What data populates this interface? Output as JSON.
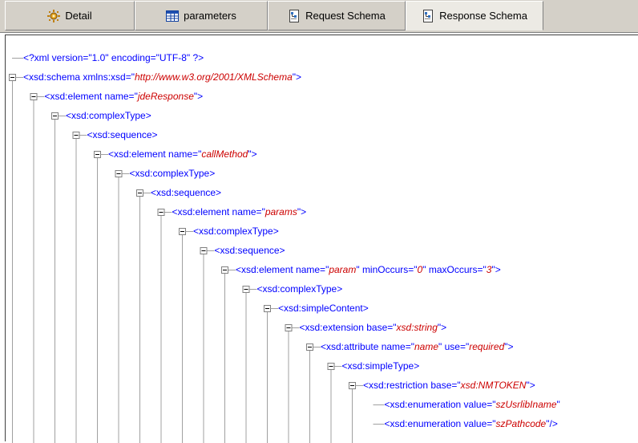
{
  "tabs": [
    {
      "label": "Detail",
      "icon": "detail-icon",
      "active": false
    },
    {
      "label": "parameters",
      "icon": "table-icon",
      "active": false
    },
    {
      "label": "Request Schema",
      "icon": "schema-icon",
      "active": false
    },
    {
      "label": "Response Schema",
      "icon": "schema-icon",
      "active": true
    }
  ],
  "tree": [
    {
      "depth": 0,
      "expander": false,
      "parts": [
        [
          "b",
          "<?xml version=\"1.0\" encoding=\"UTF-8\" ?>"
        ]
      ]
    },
    {
      "depth": 0,
      "expander": true,
      "parts": [
        [
          "b",
          "<xsd:schema xmlns:xsd=\""
        ],
        [
          "i",
          "http://www.w3.org/2001/XMLSchema"
        ],
        [
          "b",
          "\">"
        ]
      ]
    },
    {
      "depth": 1,
      "expander": true,
      "parts": [
        [
          "b",
          "<xsd:element name=\""
        ],
        [
          "i",
          "jdeResponse"
        ],
        [
          "b",
          "\">"
        ]
      ]
    },
    {
      "depth": 2,
      "expander": true,
      "parts": [
        [
          "b",
          "<xsd:complexType>"
        ]
      ]
    },
    {
      "depth": 3,
      "expander": true,
      "parts": [
        [
          "b",
          "<xsd:sequence>"
        ]
      ]
    },
    {
      "depth": 4,
      "expander": true,
      "parts": [
        [
          "b",
          "<xsd:element name=\""
        ],
        [
          "i",
          "callMethod"
        ],
        [
          "b",
          "\">"
        ]
      ]
    },
    {
      "depth": 5,
      "expander": true,
      "parts": [
        [
          "b",
          "<xsd:complexType>"
        ]
      ]
    },
    {
      "depth": 6,
      "expander": true,
      "parts": [
        [
          "b",
          "<xsd:sequence>"
        ]
      ]
    },
    {
      "depth": 7,
      "expander": true,
      "parts": [
        [
          "b",
          "<xsd:element name=\""
        ],
        [
          "i",
          "params"
        ],
        [
          "b",
          "\">"
        ]
      ]
    },
    {
      "depth": 8,
      "expander": true,
      "parts": [
        [
          "b",
          "<xsd:complexType>"
        ]
      ]
    },
    {
      "depth": 9,
      "expander": true,
      "parts": [
        [
          "b",
          "<xsd:sequence>"
        ]
      ]
    },
    {
      "depth": 10,
      "expander": true,
      "parts": [
        [
          "b",
          "<xsd:element name=\""
        ],
        [
          "i",
          "param"
        ],
        [
          "b",
          "\" minOccurs=\""
        ],
        [
          "i",
          "0"
        ],
        [
          "b",
          "\" maxOccurs=\""
        ],
        [
          "i",
          "3"
        ],
        [
          "b",
          "\">"
        ]
      ]
    },
    {
      "depth": 11,
      "expander": true,
      "parts": [
        [
          "b",
          "<xsd:complexType>"
        ]
      ]
    },
    {
      "depth": 12,
      "expander": true,
      "parts": [
        [
          "b",
          "<xsd:simpleContent>"
        ]
      ]
    },
    {
      "depth": 13,
      "expander": true,
      "parts": [
        [
          "b",
          "<xsd:extension base=\""
        ],
        [
          "i",
          "xsd:string"
        ],
        [
          "b",
          "\">"
        ]
      ]
    },
    {
      "depth": 14,
      "expander": true,
      "parts": [
        [
          "b",
          "<xsd:attribute name=\""
        ],
        [
          "i",
          "name"
        ],
        [
          "b",
          "\" use=\""
        ],
        [
          "i",
          "required"
        ],
        [
          "b",
          "\">"
        ]
      ]
    },
    {
      "depth": 15,
      "expander": true,
      "parts": [
        [
          "b",
          "<xsd:simpleType>"
        ]
      ]
    },
    {
      "depth": 16,
      "expander": true,
      "parts": [
        [
          "b",
          "<xsd:restriction base=\""
        ],
        [
          "i",
          "xsd:NMTOKEN"
        ],
        [
          "b",
          "\">"
        ]
      ]
    },
    {
      "depth": 17,
      "expander": false,
      "parts": [
        [
          "b",
          "<xsd:enumeration value=\""
        ],
        [
          "i",
          "szUsrlibIname"
        ],
        [
          "b",
          "\""
        ]
      ]
    },
    {
      "depth": 17,
      "expander": false,
      "parts": [
        [
          "b",
          "<xsd:enumeration value=\""
        ],
        [
          "i",
          "szPathcode"
        ],
        [
          "b",
          "\"/>"
        ]
      ]
    }
  ]
}
